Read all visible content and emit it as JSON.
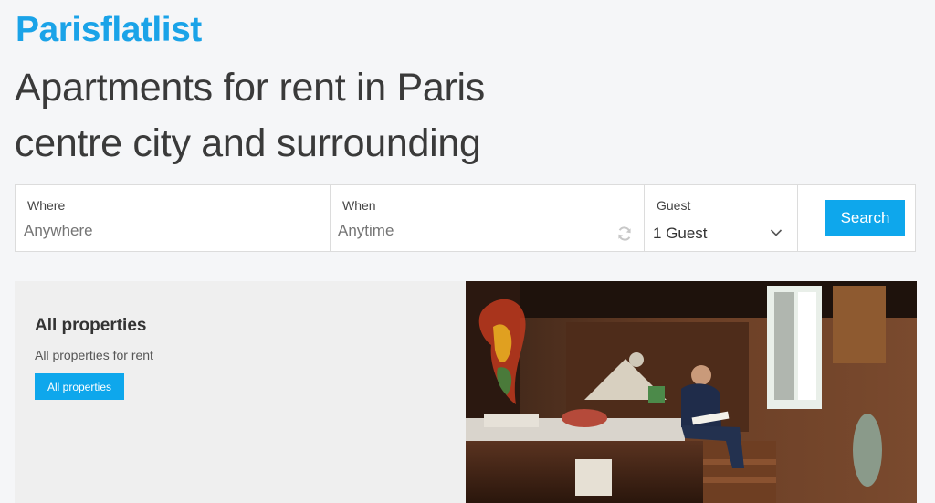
{
  "brand": {
    "logo": "Parisflatlist"
  },
  "hero": {
    "line1": "Apartments for rent in Paris",
    "line2": "centre city and surrounding"
  },
  "search": {
    "where": {
      "label": "Where",
      "placeholder": "Anywhere",
      "value": ""
    },
    "when": {
      "label": "When",
      "placeholder": "Anytime",
      "value": ""
    },
    "guest": {
      "label": "Guest",
      "selected": "1 Guest"
    },
    "button": "Search"
  },
  "card": {
    "title": "All properties",
    "subtitle": "All properties for rent",
    "button": "All properties"
  },
  "colors": {
    "brand": "#1aa3e8",
    "button": "#0ea7ec",
    "background": "#f5f6f8"
  },
  "icons": {
    "refresh": "refresh-icon",
    "chevron": "chevron-down-icon"
  }
}
